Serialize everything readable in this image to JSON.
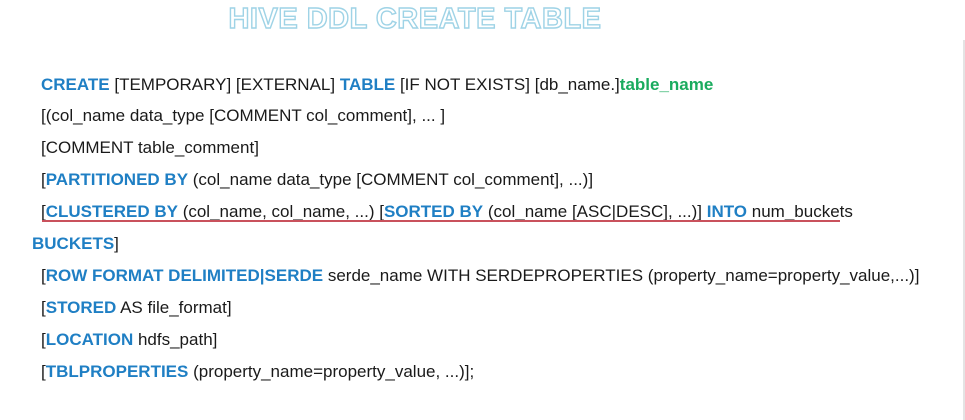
{
  "title": "HIVE DDL CREATE TABLE",
  "syntax": {
    "l1": {
      "kw_create": "CREATE",
      "t1": " [TEMPORARY] [EXTERNAL] ",
      "kw_table": "TABLE",
      "t2": " [IF NOT EXISTS] [db_name.]",
      "table_name": "table_name"
    },
    "l2": {
      "t": "[(col_name data_type [COMMENT col_comment], ... ]"
    },
    "l3": {
      "t": "[COMMENT table_comment]"
    },
    "l4": {
      "t0": "[",
      "kw": "PARTITIONED BY",
      "t1": " (col_name data_type [COMMENT col_comment], ...)]"
    },
    "l5": {
      "t0": "[",
      "kw_clustered": "CLUSTERED BY",
      "t1": " (col_name, col_name, ...) [",
      "kw_sorted": "SORTED BY",
      "t2": " (col_name [ASC|DESC], ...)] ",
      "kw_into": "INTO",
      "t3": " num_buckets"
    },
    "l6": {
      "kw": "BUCKETS",
      "t1": "]"
    },
    "l7": {
      "t0": "[",
      "kw": "ROW FORMAT DELIMITED|SERDE",
      "t1": " serde_name WITH SERDEPROPERTIES (property_name=property_value,...)]"
    },
    "l8": {
      "t0": "[",
      "kw": "STORED",
      "t1": " AS file_format]"
    },
    "l9": {
      "t0": "[",
      "kw": "LOCATION",
      "t1": " hdfs_path]"
    },
    "l10": {
      "t0": "[",
      "kw": "TBLPROPERTIES",
      "t1": " (property_name=property_value, ...)];"
    }
  },
  "colors": {
    "keyword": "#1f7fc4",
    "table_name": "#1aab5e",
    "title_outline": "#9fd3e6",
    "underline": "#c9515c"
  }
}
